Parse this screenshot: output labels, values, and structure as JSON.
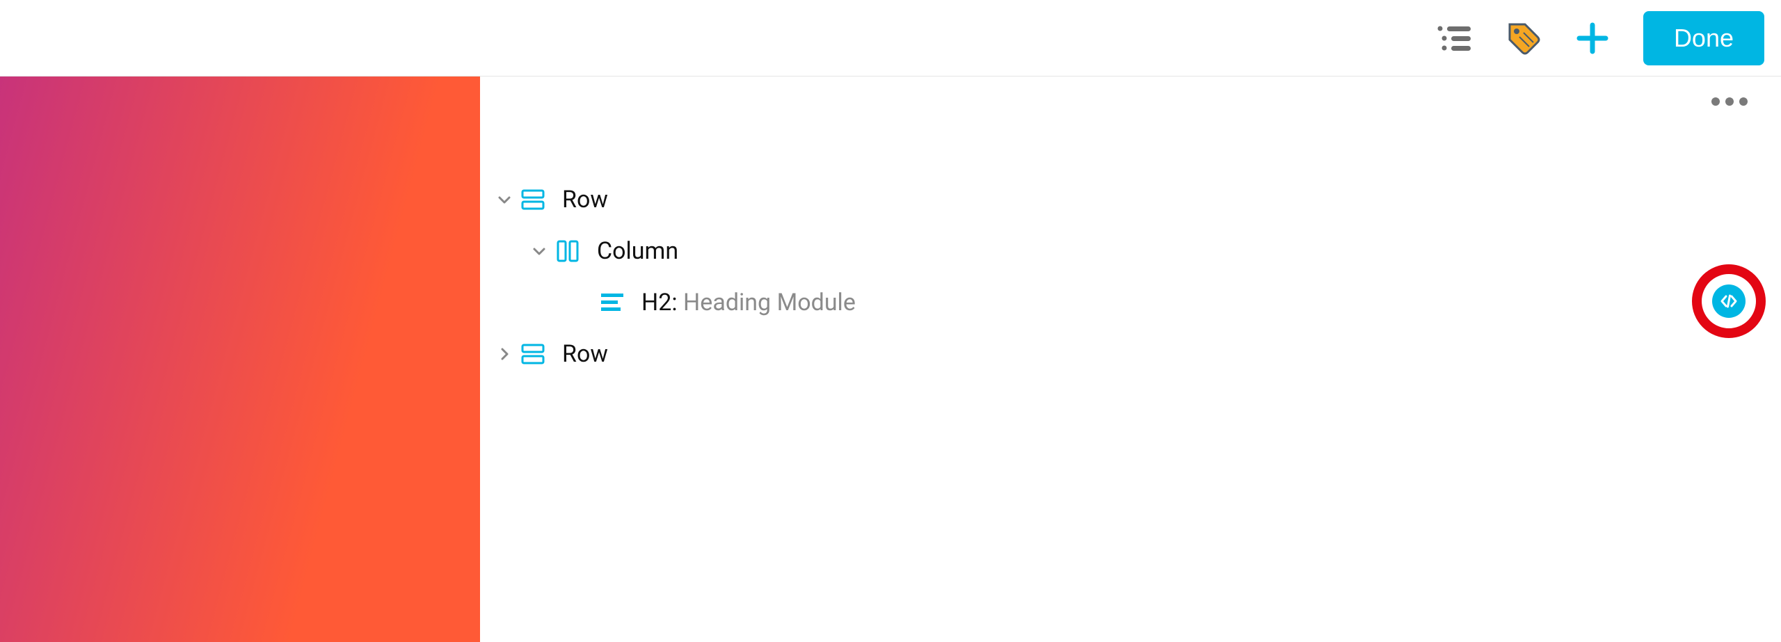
{
  "toolbar": {
    "done_label": "Done"
  },
  "outline": {
    "items": [
      {
        "label": "Row"
      },
      {
        "label": "Column"
      },
      {
        "prefix": "H2",
        "secondary": "Heading Module"
      },
      {
        "label": "Row"
      }
    ]
  },
  "colors": {
    "accent": "#00b6e3",
    "highlight_ring": "#e30613"
  }
}
